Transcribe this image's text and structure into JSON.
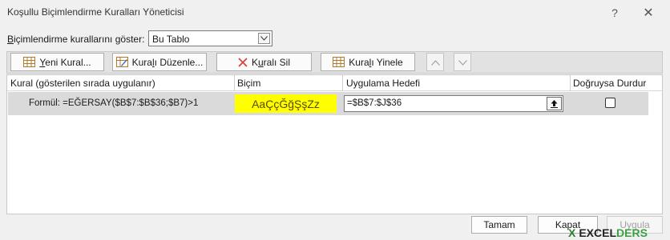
{
  "window": {
    "title": "Koşullu Biçimlendirme Kuralları Yöneticisi",
    "help": "?",
    "close": "✕"
  },
  "show": {
    "label_pre": "B",
    "label_rest": "içimlendirme kurallarını göster:",
    "value": "Bu Tablo"
  },
  "toolbar": {
    "new_pre": "",
    "new_u": "Y",
    "new_post": "eni Kural...",
    "edit_pre": "Kura",
    "edit_u": "l",
    "edit_post": "ı Düzenle...",
    "delete_pre": "K",
    "delete_u": "u",
    "delete_post": "ralı Sil",
    "dup_pre": "Kura",
    "dup_u": "l",
    "dup_post": "ı Yinele"
  },
  "table": {
    "headers": [
      "Kural (gösterilen sırada uygulanır)",
      "Biçim",
      "Uygulama Hedefi",
      "Doğruysa Durdur"
    ],
    "row": {
      "rule": "Formül: =EĞERSAY($B$7:$B$36;$B7)>1",
      "format_preview": "AaÇçĞğŞşZz",
      "applies_to": "=$B$7:$J$36",
      "stop_if_true": false
    }
  },
  "buttons": {
    "ok": "Tamam",
    "close": "Kapat",
    "apply": "Uygula"
  },
  "watermark": {
    "mark": "X",
    "text1": "EXCEL",
    "text2": "DERS"
  },
  "colors": {
    "format_bg": "#ffff00",
    "selected_row": "#dadada"
  }
}
